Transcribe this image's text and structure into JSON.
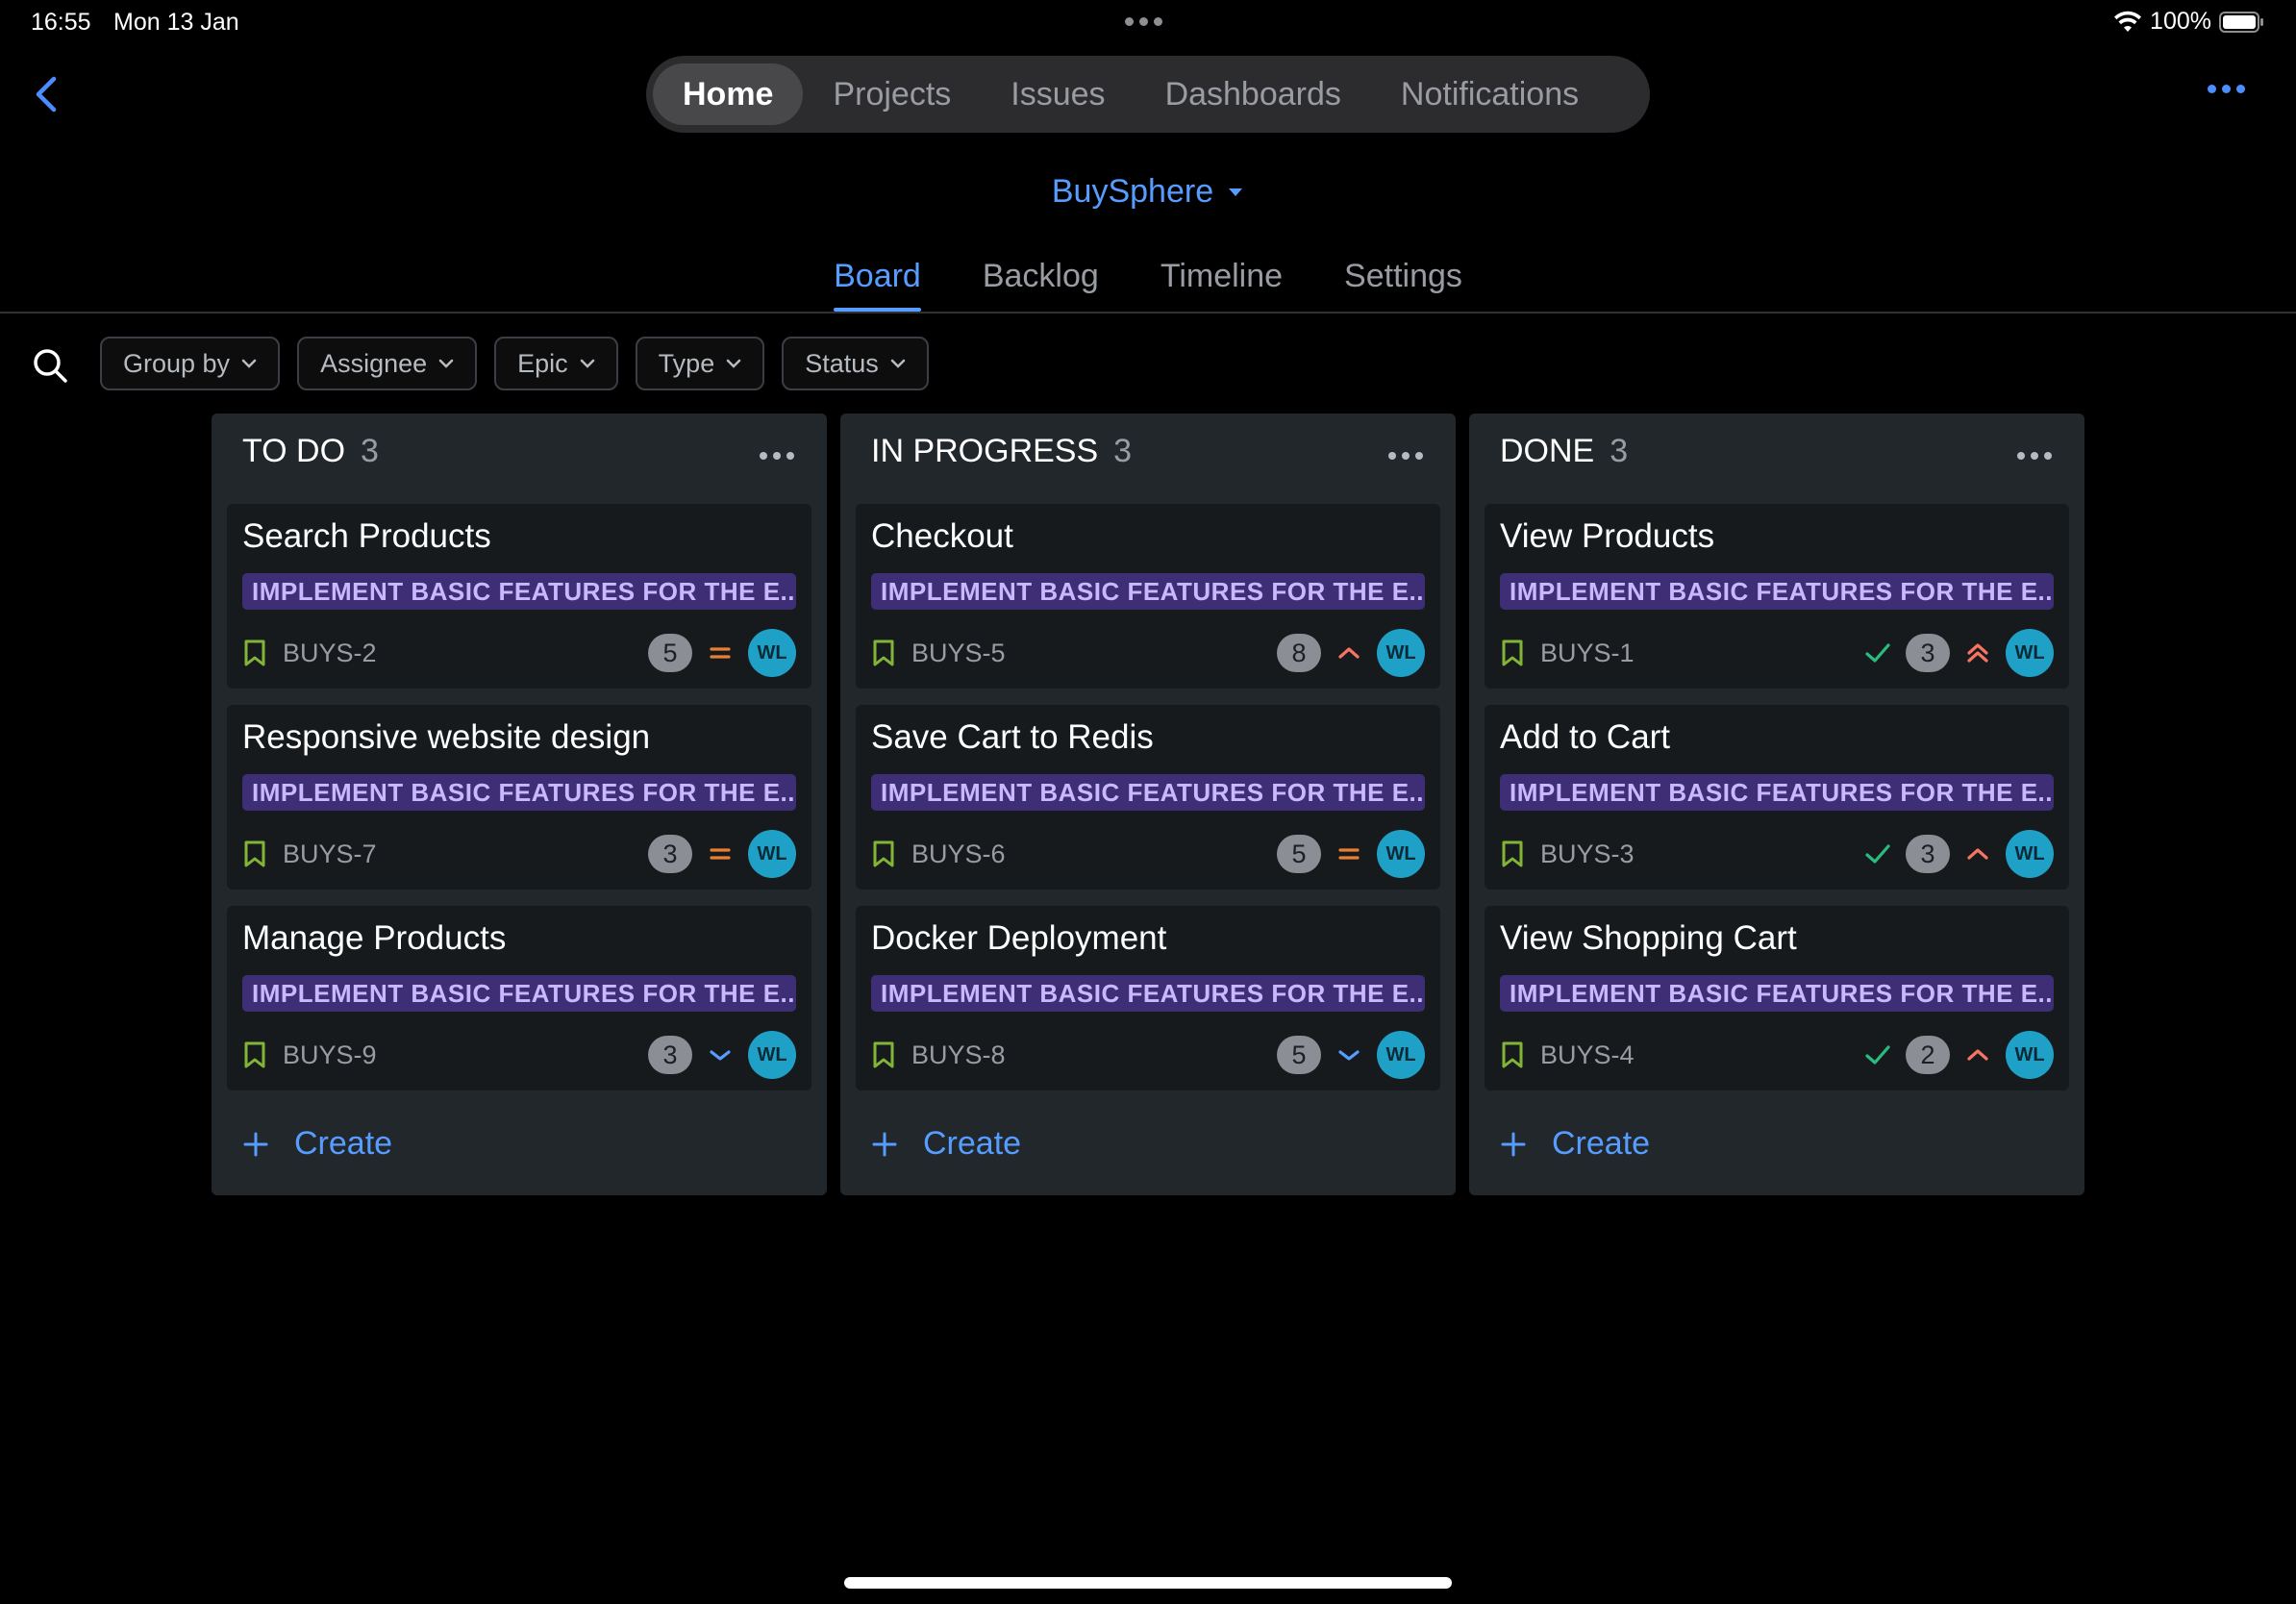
{
  "status_bar": {
    "time": "16:55",
    "date": "Mon 13 Jan",
    "battery": "100%"
  },
  "top_nav": {
    "tabs": [
      {
        "label": "Home",
        "active": true
      },
      {
        "label": "Projects",
        "active": false
      },
      {
        "label": "Issues",
        "active": false
      },
      {
        "label": "Dashboards",
        "active": false
      },
      {
        "label": "Notifications",
        "active": false
      }
    ]
  },
  "project": {
    "name": "BuySphere"
  },
  "sub_tabs": [
    {
      "label": "Board",
      "active": true
    },
    {
      "label": "Backlog",
      "active": false
    },
    {
      "label": "Timeline",
      "active": false
    },
    {
      "label": "Settings",
      "active": false
    }
  ],
  "filters": [
    {
      "label": "Group by"
    },
    {
      "label": "Assignee"
    },
    {
      "label": "Epic"
    },
    {
      "label": "Type"
    },
    {
      "label": "Status"
    }
  ],
  "colors": {
    "accent": "#579dff",
    "epic_bg": "#3d2e76",
    "story_green": "#82b536",
    "priority_medium": "#e97f33",
    "priority_high": "#f87462",
    "priority_low": "#579dff",
    "done_check": "#2abb7f",
    "avatar": "#1fa1c7"
  },
  "columns": [
    {
      "title": "TO DO",
      "count": "3",
      "create_label": "Create",
      "cards": [
        {
          "title": "Search Products",
          "epic": "IMPLEMENT BASIC FEATURES FOR THE E...",
          "key": "BUYS-2",
          "points": "5",
          "priority": "medium-icon",
          "done": false,
          "assignee": "WL"
        },
        {
          "title": "Responsive website design",
          "epic": "IMPLEMENT BASIC FEATURES FOR THE E...",
          "key": "BUYS-7",
          "points": "3",
          "priority": "medium-icon",
          "done": false,
          "assignee": "WL"
        },
        {
          "title": "Manage Products",
          "epic": "IMPLEMENT BASIC FEATURES FOR THE E...",
          "key": "BUYS-9",
          "points": "3",
          "priority": "low-icon",
          "done": false,
          "assignee": "WL"
        }
      ]
    },
    {
      "title": "IN PROGRESS",
      "count": "3",
      "create_label": "Create",
      "cards": [
        {
          "title": "Checkout",
          "epic": "IMPLEMENT BASIC FEATURES FOR THE E...",
          "key": "BUYS-5",
          "points": "8",
          "priority": "high-icon",
          "done": false,
          "assignee": "WL"
        },
        {
          "title": "Save Cart to Redis",
          "epic": "IMPLEMENT BASIC FEATURES FOR THE E...",
          "key": "BUYS-6",
          "points": "5",
          "priority": "medium-icon",
          "done": false,
          "assignee": "WL"
        },
        {
          "title": "Docker Deployment",
          "epic": "IMPLEMENT BASIC FEATURES FOR THE E...",
          "key": "BUYS-8",
          "points": "5",
          "priority": "low-icon",
          "done": false,
          "assignee": "WL"
        }
      ]
    },
    {
      "title": "DONE",
      "count": "3",
      "create_label": "Create",
      "cards": [
        {
          "title": "View Products",
          "epic": "IMPLEMENT BASIC FEATURES FOR THE E...",
          "key": "BUYS-1",
          "points": "3",
          "priority": "highest-icon",
          "done": true,
          "assignee": "WL"
        },
        {
          "title": "Add to Cart",
          "epic": "IMPLEMENT BASIC FEATURES FOR THE E...",
          "key": "BUYS-3",
          "points": "3",
          "priority": "high-icon",
          "done": true,
          "assignee": "WL"
        },
        {
          "title": "View Shopping Cart",
          "epic": "IMPLEMENT BASIC FEATURES FOR THE E...",
          "key": "BUYS-4",
          "points": "2",
          "priority": "high-icon",
          "done": true,
          "assignee": "WL"
        }
      ]
    }
  ]
}
